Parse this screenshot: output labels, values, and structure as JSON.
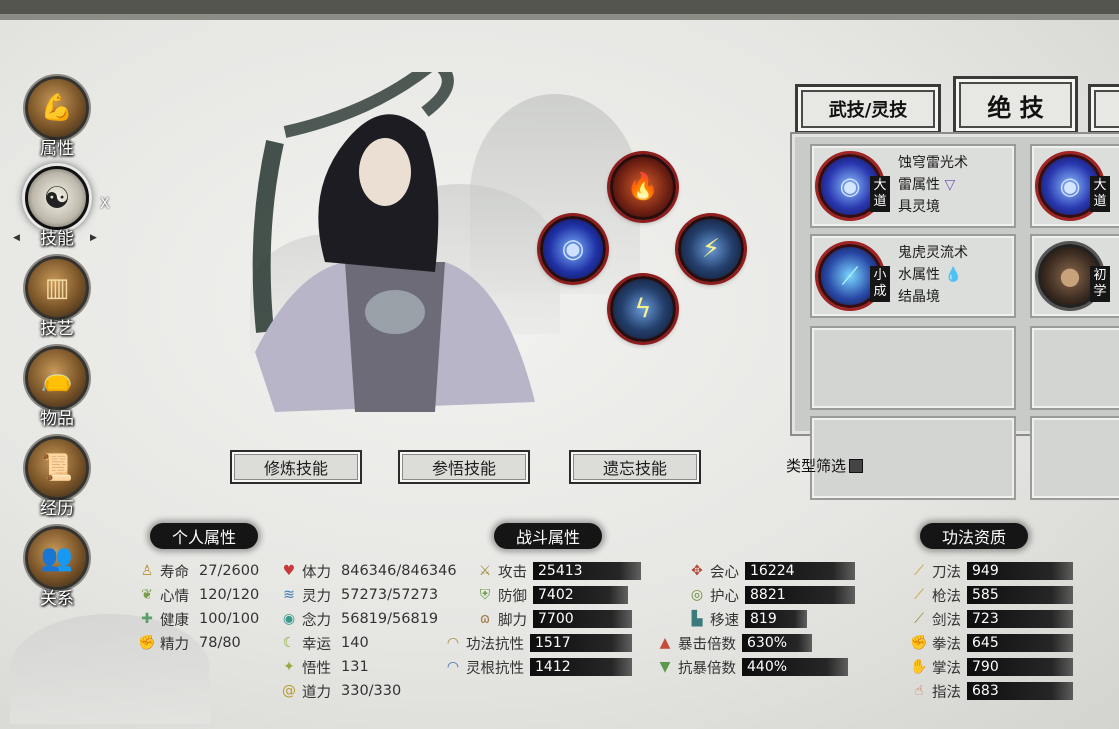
{
  "nav": {
    "items": [
      {
        "label": "属性",
        "icon": "muscle-figure-icon"
      },
      {
        "label": "技能",
        "icon": "yin-yang-icon"
      },
      {
        "label": "技艺",
        "icon": "wood-planks-icon"
      },
      {
        "label": "物品",
        "icon": "bag-icon"
      },
      {
        "label": "经历",
        "icon": "book-icon"
      },
      {
        "label": "关系",
        "icon": "people-icon"
      }
    ],
    "close_label": "X"
  },
  "tabs": [
    "武技/灵技",
    "绝 技"
  ],
  "skills": [
    {
      "name": "蚀穹雷光术",
      "element": "雷属性",
      "realm": "具灵境",
      "level": "大道"
    },
    {
      "name": "鬼虎灵流术",
      "element": "水属性",
      "realm": "结晶境",
      "level": "小成"
    }
  ],
  "skills_partial": [
    {
      "level": "大道"
    },
    {
      "level": "初学"
    }
  ],
  "actions": {
    "train": "修炼技能",
    "comprehend": "参悟技能",
    "forget": "遗忘技能"
  },
  "filter_label": "类型筛选",
  "personal": {
    "title": "个人属性",
    "rows": [
      {
        "label": "寿命",
        "value": "27/2600",
        "icon": "figure-icon",
        "color": "#b8902e"
      },
      {
        "label": "心情",
        "value": "120/120",
        "icon": "sprout-icon",
        "color": "#7aa04c"
      },
      {
        "label": "健康",
        "value": "100/100",
        "icon": "cross-icon",
        "color": "#5aa06a"
      },
      {
        "label": "精力",
        "value": "78/80",
        "icon": "arm-icon",
        "color": "#b86a3c"
      }
    ],
    "rows2": [
      {
        "label": "体力",
        "value": "846346/846346",
        "icon": "heart-icon",
        "color": "#c83a3a"
      },
      {
        "label": "灵力",
        "value": "57273/57273",
        "icon": "wave-icon",
        "color": "#3a7ab8"
      },
      {
        "label": "念力",
        "value": "56819/56819",
        "icon": "eye-icon",
        "color": "#3a9a8a"
      },
      {
        "label": "幸运",
        "value": "140",
        "icon": "moon-icon",
        "color": "#8aaa3a"
      },
      {
        "label": "悟性",
        "value": "131",
        "icon": "star-icon",
        "color": "#9aaa3a"
      },
      {
        "label": "道力",
        "value": "330/330",
        "icon": "spiral-icon",
        "color": "#b89a2a"
      }
    ]
  },
  "combat": {
    "title": "战斗属性",
    "rows": [
      {
        "label": "攻击",
        "value": "25413",
        "icon": "crossed-swords-icon",
        "color": "#a08a3a"
      },
      {
        "label": "防御",
        "value": "7402",
        "icon": "shield-icon",
        "color": "#6a9a4a"
      },
      {
        "label": "脚力",
        "value": "7700",
        "icon": "feet-icon",
        "color": "#a07a4a"
      },
      {
        "label": "功法抗性",
        "value": "1517",
        "icon": "dome-icon",
        "color": "#a08a3a"
      },
      {
        "label": "灵根抗性",
        "value": "1412",
        "icon": "dome-blue-icon",
        "color": "#3a6aa8"
      }
    ],
    "rows2": [
      {
        "label": "会心",
        "value": "16224",
        "icon": "tri-blade-icon",
        "color": "#b84a3a"
      },
      {
        "label": "护心",
        "value": "8821",
        "icon": "round-shield-icon",
        "color": "#6a8a3a"
      },
      {
        "label": "移速",
        "value": "819",
        "icon": "boot-icon",
        "color": "#3a7a7a"
      },
      {
        "label": "暴击倍数",
        "value": "630%",
        "icon": "triangle-up-icon",
        "color": "#c84a3a"
      },
      {
        "label": "抗暴倍数",
        "value": "440%",
        "icon": "triangle-down-icon",
        "color": "#5a9a4a"
      }
    ]
  },
  "aptitude": {
    "title": "功法资质",
    "rows": [
      {
        "label": "刀法",
        "value": "949",
        "icon": "blade-icon",
        "color": "#c89a2a"
      },
      {
        "label": "枪法",
        "value": "585",
        "icon": "spear-icon",
        "color": "#c89a2a"
      },
      {
        "label": "剑法",
        "value": "723",
        "icon": "sword-icon",
        "color": "#a08a3a"
      },
      {
        "label": "拳法",
        "value": "645",
        "icon": "fist-icon",
        "color": "#c8643a"
      },
      {
        "label": "掌法",
        "value": "790",
        "icon": "palm-icon",
        "color": "#c8643a"
      },
      {
        "label": "指法",
        "value": "683",
        "icon": "finger-icon",
        "color": "#c86a4a"
      }
    ]
  }
}
